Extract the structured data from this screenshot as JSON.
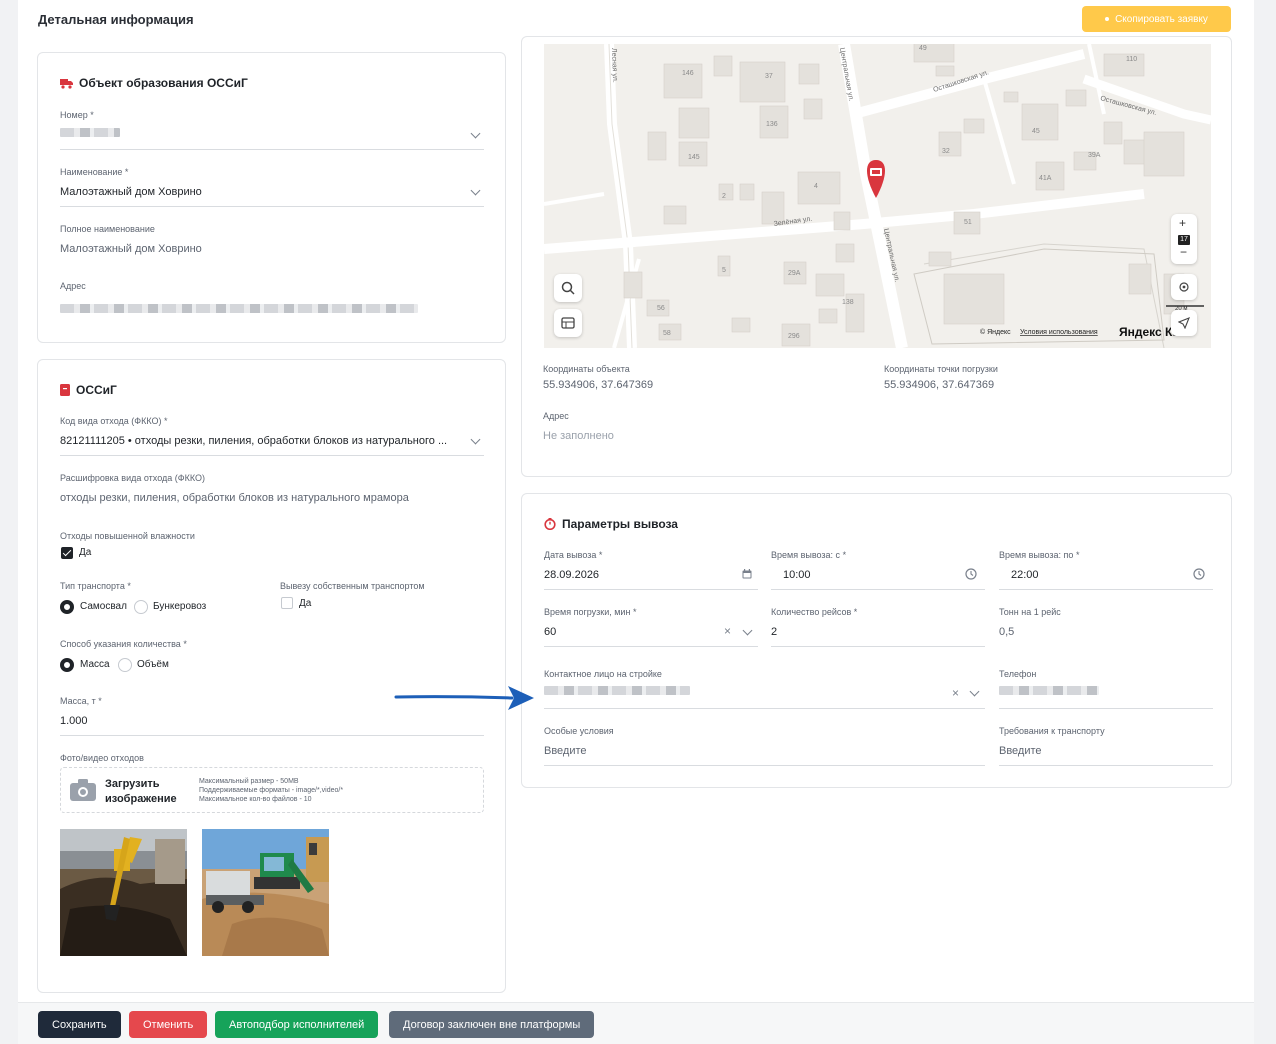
{
  "header": {
    "title": "Детальная информация",
    "copy_button": "Скопировать заявку"
  },
  "object_card": {
    "title": "Объект образования ОССиГ",
    "number_label": "Номер",
    "name_label": "Наименование",
    "name_value": "Малоэтажный дом Ховрино",
    "full_name_label": "Полное наименование",
    "full_name_value": "Малоэтажный дом Ховрино",
    "address_label": "Адрес"
  },
  "waste_card": {
    "title": "ОССиГ",
    "fkko_label": "Код вида отхода (ФККО)",
    "fkko_value": "82121111205 • отходы резки, пиления, обработки блоков из натурального ...",
    "decode_label": "Расшифровка вида отхода (ФККО)",
    "decode_value": "отходы резки, пиления, обработки блоков из натурального мрамора",
    "moisture_label": "Отходы повышенной влажности",
    "moisture_option": "Да",
    "transport_label": "Тип транспорта",
    "transport_options": [
      "Самосвал",
      "Бункеровоз"
    ],
    "own_transport_label": "Вывезу собственным транспортом",
    "own_transport_option": "Да",
    "quantity_method_label": "Способ указания количества",
    "quantity_options": [
      "Масса",
      "Объём"
    ],
    "mass_label": "Масса, т",
    "mass_value": "1.000",
    "photos_label": "Фото/видео отходов",
    "upload_title_line1": "Загрузить",
    "upload_title_line2": "изображение",
    "upload_hint_1": "Максимальный размер - 50MB",
    "upload_hint_2": "Поддерживаемые форматы - image/*,video/*",
    "upload_hint_3": "Максимальное кол-во файлов - 10"
  },
  "map_card": {
    "streets": [
      "Останкинская ул.",
      "Осташковская ул.",
      "Зелёная ул.",
      "Центральная ул.",
      "Центральная ул.",
      "Лесная ул."
    ],
    "house_numbers": [
      "146",
      "37",
      "49",
      "110",
      "136",
      "145",
      "45",
      "32",
      "39А",
      "41А",
      "4",
      "2",
      "51",
      "5",
      "29А",
      "138",
      "56",
      "58",
      "296"
    ],
    "zoom_level": "17",
    "scale": "20 м",
    "copyright": "© Яндекс",
    "terms_link": "Условия использования",
    "brand": "Яндекс Ка",
    "coords_label": "Координаты объекта",
    "coords_value": "55.934906, 37.647369",
    "load_coords_label": "Координаты точки погрузки",
    "load_coords_value": "55.934906, 37.647369",
    "address_label": "Адрес",
    "address_value": "Не заполнено"
  },
  "params_card": {
    "title": "Параметры вывоза",
    "date_label": "Дата вывоза",
    "date_value": "28.09.2026",
    "time_from_label": "Время вывоза: с",
    "time_from_value": "10:00",
    "time_to_label": "Время вывоза: по",
    "time_to_value": "22:00",
    "load_time_label": "Время погрузки, мин",
    "load_time_value": "60",
    "trips_label": "Количество рейсов",
    "trips_value": "2",
    "tons_label": "Тонн на 1 рейс",
    "tons_value": "0,5",
    "contact_label": "Контактное лицо на стройке",
    "phone_label": "Телефон",
    "special_label": "Особые условия",
    "special_placeholder": "Введите",
    "transport_req_label": "Требования к транспорту",
    "transport_req_placeholder": "Введите"
  },
  "bottom_bar": {
    "save": "Сохранить",
    "cancel": "Отменить",
    "auto_select": "Автоподбор исполнителей",
    "contract": "Договор заключен вне платформы"
  },
  "required_mark": "*",
  "colors": {
    "accent_yellow": "#ffc94a",
    "save": "#1f2a3a",
    "cancel": "#e5484d",
    "auto": "#16a35a",
    "contract": "#5f6b7a",
    "red_icon": "#d9363e",
    "arrow": "#1d5fb8"
  },
  "icons": [
    "truck-icon",
    "bin-icon",
    "timer-icon",
    "calendar-icon",
    "clock-icon",
    "camera-icon",
    "search-icon",
    "layers-icon",
    "plus-icon",
    "minus-icon",
    "locate-icon",
    "navigate-icon",
    "map-pin-icon",
    "clear-icon",
    "chevron-down-icon",
    "arrow-annotation"
  ]
}
